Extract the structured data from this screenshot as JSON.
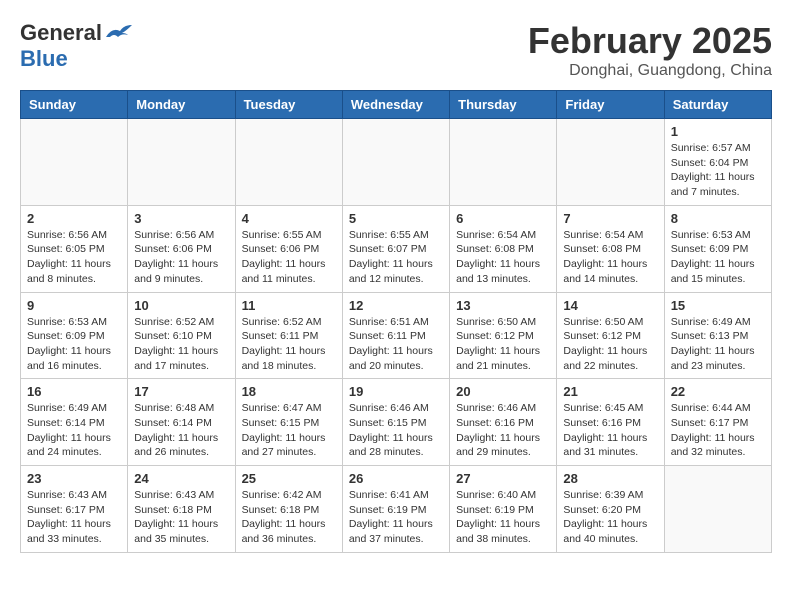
{
  "header": {
    "logo_general": "General",
    "logo_blue": "Blue",
    "month_title": "February 2025",
    "location": "Donghai, Guangdong, China"
  },
  "weekdays": [
    "Sunday",
    "Monday",
    "Tuesday",
    "Wednesday",
    "Thursday",
    "Friday",
    "Saturday"
  ],
  "weeks": [
    [
      {
        "day": "",
        "info": ""
      },
      {
        "day": "",
        "info": ""
      },
      {
        "day": "",
        "info": ""
      },
      {
        "day": "",
        "info": ""
      },
      {
        "day": "",
        "info": ""
      },
      {
        "day": "",
        "info": ""
      },
      {
        "day": "1",
        "info": "Sunrise: 6:57 AM\nSunset: 6:04 PM\nDaylight: 11 hours and 7 minutes."
      }
    ],
    [
      {
        "day": "2",
        "info": "Sunrise: 6:56 AM\nSunset: 6:05 PM\nDaylight: 11 hours and 8 minutes."
      },
      {
        "day": "3",
        "info": "Sunrise: 6:56 AM\nSunset: 6:06 PM\nDaylight: 11 hours and 9 minutes."
      },
      {
        "day": "4",
        "info": "Sunrise: 6:55 AM\nSunset: 6:06 PM\nDaylight: 11 hours and 11 minutes."
      },
      {
        "day": "5",
        "info": "Sunrise: 6:55 AM\nSunset: 6:07 PM\nDaylight: 11 hours and 12 minutes."
      },
      {
        "day": "6",
        "info": "Sunrise: 6:54 AM\nSunset: 6:08 PM\nDaylight: 11 hours and 13 minutes."
      },
      {
        "day": "7",
        "info": "Sunrise: 6:54 AM\nSunset: 6:08 PM\nDaylight: 11 hours and 14 minutes."
      },
      {
        "day": "8",
        "info": "Sunrise: 6:53 AM\nSunset: 6:09 PM\nDaylight: 11 hours and 15 minutes."
      }
    ],
    [
      {
        "day": "9",
        "info": "Sunrise: 6:53 AM\nSunset: 6:09 PM\nDaylight: 11 hours and 16 minutes."
      },
      {
        "day": "10",
        "info": "Sunrise: 6:52 AM\nSunset: 6:10 PM\nDaylight: 11 hours and 17 minutes."
      },
      {
        "day": "11",
        "info": "Sunrise: 6:52 AM\nSunset: 6:11 PM\nDaylight: 11 hours and 18 minutes."
      },
      {
        "day": "12",
        "info": "Sunrise: 6:51 AM\nSunset: 6:11 PM\nDaylight: 11 hours and 20 minutes."
      },
      {
        "day": "13",
        "info": "Sunrise: 6:50 AM\nSunset: 6:12 PM\nDaylight: 11 hours and 21 minutes."
      },
      {
        "day": "14",
        "info": "Sunrise: 6:50 AM\nSunset: 6:12 PM\nDaylight: 11 hours and 22 minutes."
      },
      {
        "day": "15",
        "info": "Sunrise: 6:49 AM\nSunset: 6:13 PM\nDaylight: 11 hours and 23 minutes."
      }
    ],
    [
      {
        "day": "16",
        "info": "Sunrise: 6:49 AM\nSunset: 6:14 PM\nDaylight: 11 hours and 24 minutes."
      },
      {
        "day": "17",
        "info": "Sunrise: 6:48 AM\nSunset: 6:14 PM\nDaylight: 11 hours and 26 minutes."
      },
      {
        "day": "18",
        "info": "Sunrise: 6:47 AM\nSunset: 6:15 PM\nDaylight: 11 hours and 27 minutes."
      },
      {
        "day": "19",
        "info": "Sunrise: 6:46 AM\nSunset: 6:15 PM\nDaylight: 11 hours and 28 minutes."
      },
      {
        "day": "20",
        "info": "Sunrise: 6:46 AM\nSunset: 6:16 PM\nDaylight: 11 hours and 29 minutes."
      },
      {
        "day": "21",
        "info": "Sunrise: 6:45 AM\nSunset: 6:16 PM\nDaylight: 11 hours and 31 minutes."
      },
      {
        "day": "22",
        "info": "Sunrise: 6:44 AM\nSunset: 6:17 PM\nDaylight: 11 hours and 32 minutes."
      }
    ],
    [
      {
        "day": "23",
        "info": "Sunrise: 6:43 AM\nSunset: 6:17 PM\nDaylight: 11 hours and 33 minutes."
      },
      {
        "day": "24",
        "info": "Sunrise: 6:43 AM\nSunset: 6:18 PM\nDaylight: 11 hours and 35 minutes."
      },
      {
        "day": "25",
        "info": "Sunrise: 6:42 AM\nSunset: 6:18 PM\nDaylight: 11 hours and 36 minutes."
      },
      {
        "day": "26",
        "info": "Sunrise: 6:41 AM\nSunset: 6:19 PM\nDaylight: 11 hours and 37 minutes."
      },
      {
        "day": "27",
        "info": "Sunrise: 6:40 AM\nSunset: 6:19 PM\nDaylight: 11 hours and 38 minutes."
      },
      {
        "day": "28",
        "info": "Sunrise: 6:39 AM\nSunset: 6:20 PM\nDaylight: 11 hours and 40 minutes."
      },
      {
        "day": "",
        "info": ""
      }
    ]
  ]
}
